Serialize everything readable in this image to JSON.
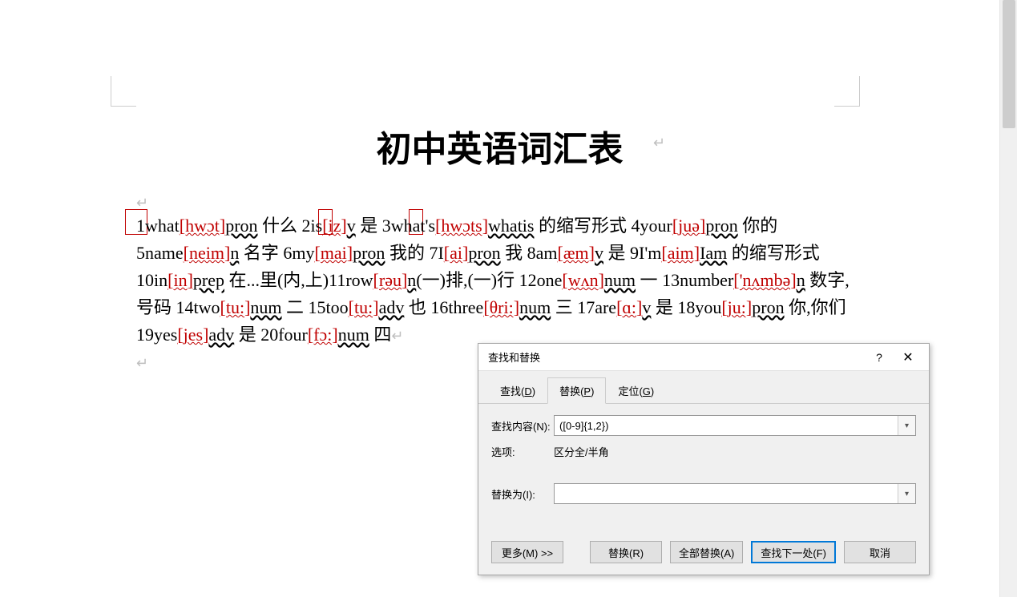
{
  "document": {
    "title": "初中英语词汇表",
    "entries": [
      {
        "n": "1",
        "w": "what",
        "ph": "[hwɔt]",
        "pos": "pron",
        "gloss": " 什么 "
      },
      {
        "n": "2",
        "w": "is",
        "ph": "[iz]",
        "pos": "v",
        "gloss": " 是 "
      },
      {
        "n": "3",
        "w": "what's",
        "ph": "[hwɔts]",
        "pos": "whatis",
        "gloss": " 的缩写形式 "
      },
      {
        "n": "4",
        "w": "your",
        "ph": "[juə]",
        "pos": "pron",
        "gloss": " 你的 "
      },
      {
        "n": "5",
        "w": "name",
        "ph": "[neim]",
        "pos": "n",
        "gloss": " 名字 "
      },
      {
        "n": "6",
        "w": "my",
        "ph": "[mai]",
        "pos": "pron",
        "gloss": " 我的 "
      },
      {
        "n": "7",
        "w": "I",
        "ph": "[ai]",
        "pos": "pron",
        "gloss": " 我 "
      },
      {
        "n": "8",
        "w": "am",
        "ph": "[æm]",
        "pos": "v",
        "gloss": " 是 "
      },
      {
        "n": "9",
        "w": "I'm",
        "ph": "[aim]",
        "pos": "Iam",
        "gloss": " 的缩写形式 "
      },
      {
        "n": "10",
        "w": "in",
        "ph": "[in]",
        "pos": "prep",
        "gloss": " 在...里(内,上)"
      },
      {
        "n": "11",
        "w": "row",
        "ph": "[rəu]",
        "pos": "n",
        "gloss": "(一)排,(一)行 "
      },
      {
        "n": "12",
        "w": "one",
        "ph": "[wʌn]",
        "pos": "num",
        "gloss": " 一 "
      },
      {
        "n": "13",
        "w": "number",
        "ph": "['nʌmbə]",
        "pos": "n",
        "gloss": " 数字,号码 "
      },
      {
        "n": "14",
        "w": "two",
        "ph": "[tu:]",
        "pos": "num",
        "gloss": " 二 "
      },
      {
        "n": "15",
        "w": "too",
        "ph": "[tu:]",
        "pos": "adv",
        "gloss": " 也 "
      },
      {
        "n": "16",
        "w": "three",
        "ph": "[θri:]",
        "pos": "num",
        "gloss": " 三 "
      },
      {
        "n": "17",
        "w": "are",
        "ph": "[ɑ:]",
        "pos": "v",
        "gloss": " 是 "
      },
      {
        "n": "18",
        "w": "you",
        "ph": "[ju:]",
        "pos": "pron",
        "gloss": " 你,你们 "
      },
      {
        "n": "19",
        "w": "yes",
        "ph": "[jes]",
        "pos": "adv",
        "gloss": " 是 "
      },
      {
        "n": "20",
        "w": "four",
        "ph": "[fɔ:]",
        "pos": "num",
        "gloss": " 四"
      }
    ]
  },
  "dialog": {
    "title": "查找和替换",
    "help_symbol": "?",
    "close_symbol": "✕",
    "tabs": {
      "find": "查找(D)",
      "replace": "替换(P)",
      "goto": "定位(G)"
    },
    "labels": {
      "find_what": "查找内容(N):",
      "options": "选项:",
      "options_value": "区分全/半角",
      "replace_with": "替换为(I):"
    },
    "find_value": "([0-9]{1,2})",
    "replace_value": "",
    "buttons": {
      "more": "更多(M) >>",
      "replace": "替换(R)",
      "replace_all": "全部替换(A)",
      "find_next": "查找下一处(F)",
      "cancel": "取消"
    }
  }
}
